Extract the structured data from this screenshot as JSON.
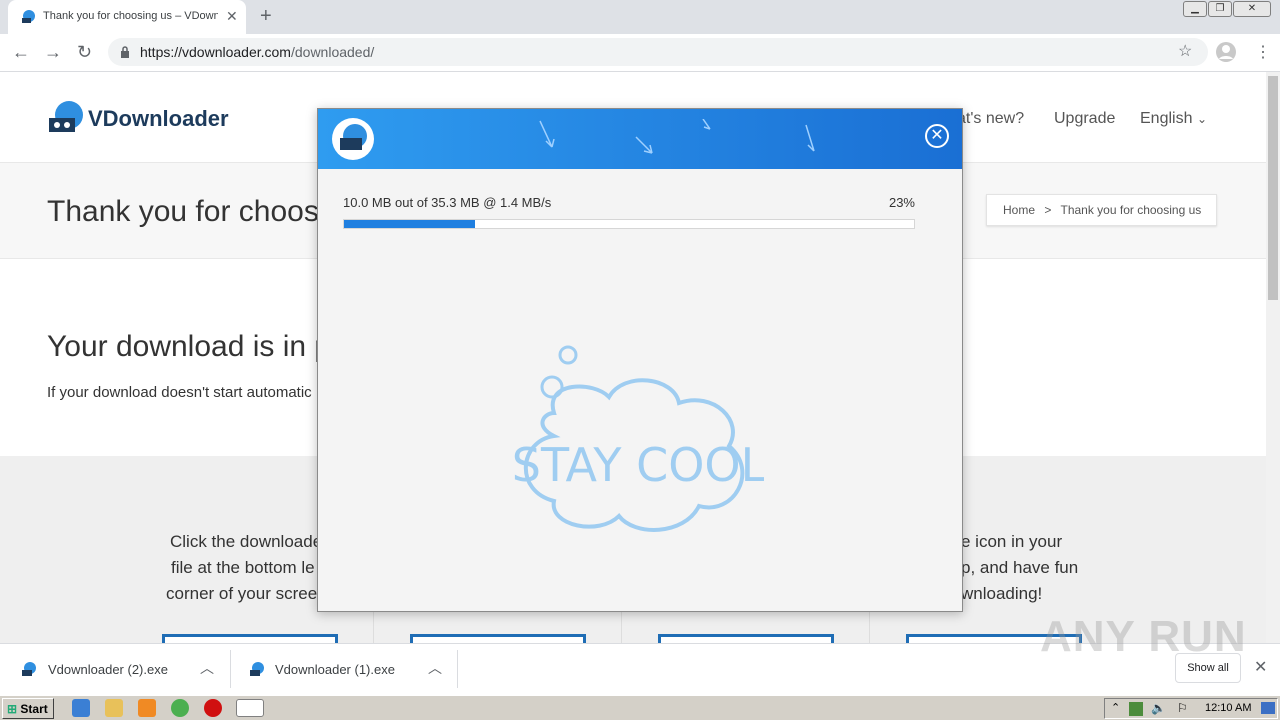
{
  "browser": {
    "tab_title": "Thank you for choosing us – VDownl",
    "tab_close": "✕",
    "new_tab": "+",
    "url_host": "https://vdownloader.com",
    "url_path": "/downloaded/"
  },
  "site": {
    "logo": "VDownloader",
    "nav": {
      "whats_new": "at's new?",
      "upgrade": "Upgrade",
      "language": "English"
    },
    "hero_title": "Thank you for choos",
    "breadcrumb": {
      "home": "Home",
      "separator": ">",
      "current": "Thank you for choosing us"
    },
    "download_title": "Your download is in p",
    "download_text": "If your download doesn't start automatic",
    "col1": [
      "Click the downloade",
      "file at the bottom le",
      "corner of your scree"
    ],
    "col4": [
      "e icon in your",
      "p, and have fun",
      "wnloading!"
    ]
  },
  "modal": {
    "progress_text": "10.0 MB out of 35.3 MB @ 1.4 MB/s",
    "progress_percent": "23%",
    "progress_value": 0.23,
    "close_icon": "close-icon",
    "illustration_text": "STAY COOL"
  },
  "downloads": {
    "items": [
      {
        "name": "Vdownloader (2).exe"
      },
      {
        "name": "Vdownloader (1).exe"
      }
    ],
    "show_all": "Show all",
    "close": "✕"
  },
  "watermark": "ANY RUN",
  "taskbar": {
    "start": "Start",
    "clock": "12:10 AM"
  },
  "colors": {
    "accent": "#1f7fe0",
    "modal_header_start": "#2f9cf0",
    "modal_header_end": "#1a6fd4",
    "stay_cool": "#9fcdf1"
  }
}
